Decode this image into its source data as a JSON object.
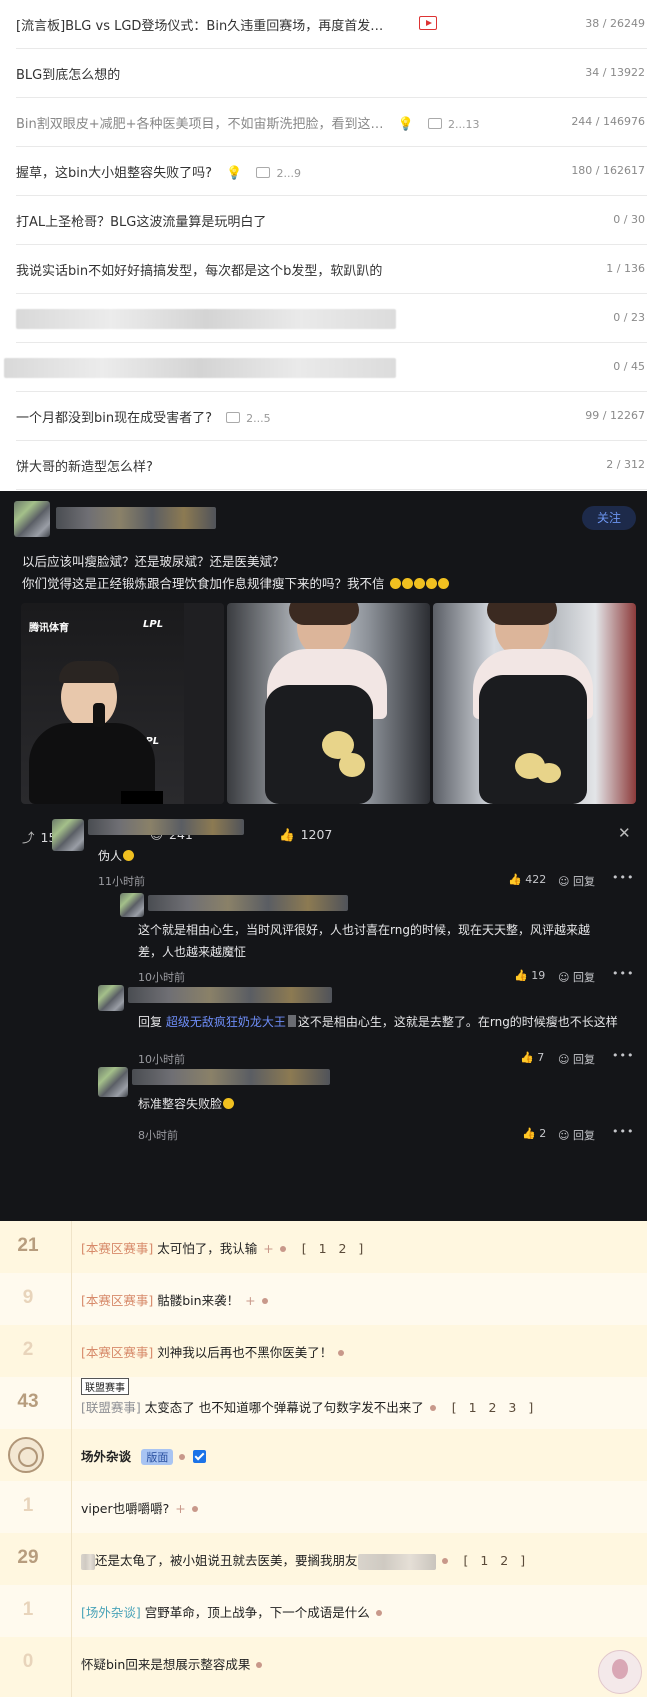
{
  "forum_list": {
    "threads": [
      {
        "title": "[流言板]BLG vs LGD登场仪式：Bin久违重回赛场，再度首发…",
        "stats": "38 / 26249",
        "has_video": true
      },
      {
        "title": "BLG到底怎么想的",
        "stats": "34 / 13922"
      },
      {
        "title": "Bin割双眼皮+减肥+各种医美项目，不如宙斯洗把脸，看到这…",
        "stats": "244 / 146976",
        "pages": "2...13",
        "muted": true
      },
      {
        "title": "握草，这bin大小姐整容失败了吗?",
        "stats": "180 / 162617",
        "pages": "2...9"
      },
      {
        "title": "打AL上圣枪哥？BLG这波流量算是玩明白了",
        "stats": "0 / 30"
      },
      {
        "title": "我说实话bin不如好好搞搞发型，每次都是这个b发型，软趴趴的",
        "stats": "1 / 136"
      },
      {
        "title": "",
        "stats": "0 / 23"
      },
      {
        "title": "",
        "stats": "0 / 45"
      },
      {
        "title": "一个月都没到bin现在成受害者了?",
        "stats": "99 / 12267",
        "pages": "2...5"
      },
      {
        "title": "饼大哥的新造型怎么样?",
        "stats": "2 / 312"
      }
    ]
  },
  "post": {
    "follow_label": "关注",
    "text_line1": "以后应该叫瘦脸斌？还是玻尿斌？还是医美斌？",
    "text_line2": "你们觉得这是正经锻炼跟合理饮食加作息规律瘦下来的吗？我不信",
    "photo1_logos": {
      "left": "腾讯体育",
      "right": "LPL"
    },
    "photo1_logo_bottom": "LPL",
    "actions": {
      "share": "15",
      "comment": "241",
      "like": "1207"
    },
    "comments": [
      {
        "text": "伪人",
        "time": "11小时前",
        "likes": "422",
        "reply": "回复"
      },
      {
        "text_line1": "这个就是相由心生，当时风评很好，人也讨喜在rng的时候，现在天天整，风评越来越",
        "text_line2": "差，人也越来越魔怔",
        "time": "10小时前",
        "likes": "19",
        "reply": "回复"
      },
      {
        "prefix": "回复",
        "mention": "超级无敌疯狂奶龙大王",
        "text": "这不是相由心生，这就是去整了。在rng的时候瘦也不长这样",
        "time": "10小时前",
        "likes": "7",
        "reply": "回复"
      },
      {
        "text": "标准整容失败脸",
        "time": "8小时前",
        "likes": "2",
        "reply": "回复"
      }
    ]
  },
  "forum2": {
    "rows": [
      {
        "count": "21",
        "tag": "[本赛区赛事]",
        "title": "太可怕了，我认输",
        "pages": "[ 1 2 ]"
      },
      {
        "count": "9",
        "tag": "[本赛区赛事]",
        "title": "骷髅bin来袭！"
      },
      {
        "count": "2",
        "tag": "[本赛区赛事]",
        "title": "刘神我以后再也不黑你医美了！"
      },
      {
        "count": "43",
        "tooltip": "联盟赛事",
        "tag": "[联盟赛事]",
        "title": "太变态了 也不知道哪个弹幕说了句数字发不出来了",
        "pages": "[ 1 2 3 ]"
      },
      {
        "title": "场外杂谈",
        "badge": "版面"
      },
      {
        "count": "1",
        "title": "viper也嚼嚼嚼?"
      },
      {
        "count": "29",
        "title_start": "还是太龟了，被小姐说丑就去医美，要搁我朋友",
        "pages": "[ 1 2 ]"
      },
      {
        "count": "1",
        "tag": "[场外杂谈]",
        "title": "宫野革命，顶上战争，下一个成语是什么"
      },
      {
        "count": "0",
        "title": "怀疑bin回来是想展示整容成果"
      }
    ]
  }
}
